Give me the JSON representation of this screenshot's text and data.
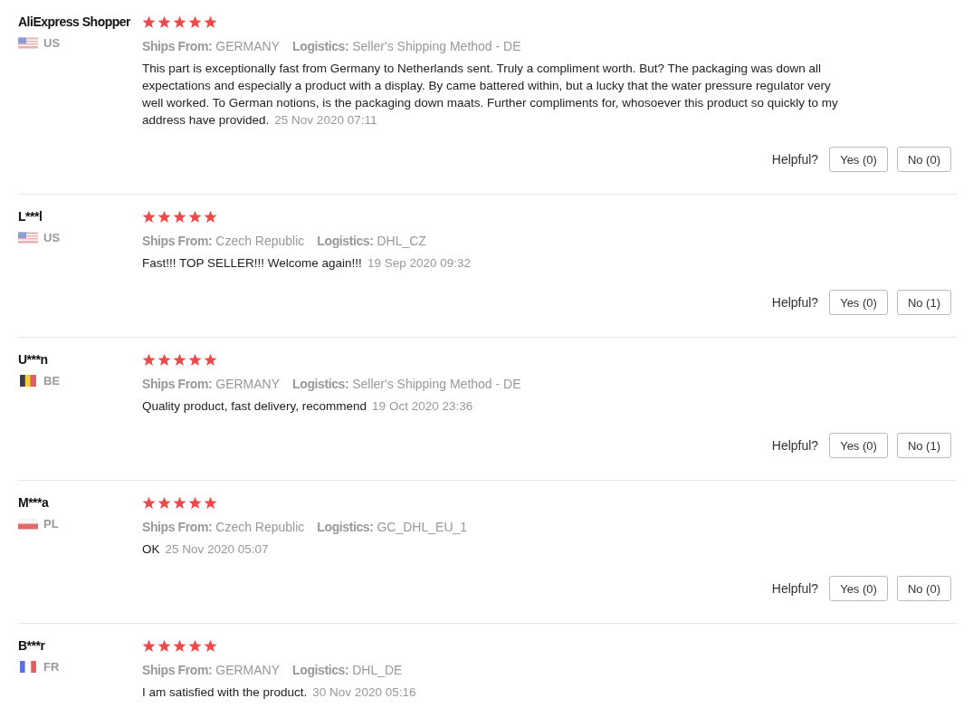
{
  "reviews": [
    {
      "name": "AliExpress Shopper",
      "kind": "us",
      "country": "US",
      "stars": 5,
      "ships_from_label": "Ships From:",
      "ships_from": "GERMANY",
      "logistics_label": "Logistics:",
      "logistics": "Seller's Shipping Method - DE",
      "text": "This part is exceptionally fast from Germany to Netherlands sent. Truly a compliment worth. But? The packaging was down all expectations and especially a product with a display. By came battered within, but a lucky that the water pressure regulator very well worked. To German notions, is the packaging down maats. Further compliments for, whosoever this product so quickly to my address have provided.",
      "date": "25 Nov 2020 07:11",
      "helpful": {
        "label": "Helpful?",
        "yes": "Yes (0)",
        "no": "No (0)"
      }
    },
    {
      "name": "L***l",
      "kind": "us",
      "country": "US",
      "stars": 5,
      "ships_from_label": "Ships From:",
      "ships_from": "Czech Republic",
      "logistics_label": "Logistics:",
      "logistics": "DHL_CZ",
      "text": "Fast!!! TOP SELLER!!! Welcome again!!!",
      "date": "19 Sep 2020 09:32",
      "helpful": {
        "label": "Helpful?",
        "yes": "Yes (0)",
        "no": "No (1)"
      }
    },
    {
      "name": "U***n",
      "kind": "be",
      "country": "BE",
      "stars": 5,
      "ships_from_label": "Ships From:",
      "ships_from": "GERMANY",
      "logistics_label": "Logistics:",
      "logistics": "Seller's Shipping Method - DE",
      "text": "Quality product, fast delivery, recommend",
      "date": "19 Oct 2020 23:36",
      "helpful": {
        "label": "Helpful?",
        "yes": "Yes (0)",
        "no": "No (1)"
      }
    },
    {
      "name": "M***a",
      "kind": "pl",
      "country": "PL",
      "stars": 5,
      "ships_from_label": "Ships From:",
      "ships_from": "Czech Republic",
      "logistics_label": "Logistics:",
      "logistics": "GC_DHL_EU_1",
      "text": "OK",
      "date": "25 Nov 2020 05:07",
      "helpful": {
        "label": "Helpful?",
        "yes": "Yes (0)",
        "no": "No (0)"
      }
    },
    {
      "name": "B***r",
      "kind": "fr",
      "country": "FR",
      "stars": 5,
      "ships_from_label": "Ships From:",
      "ships_from": "GERMANY",
      "logistics_label": "Logistics:",
      "logistics": "DHL_DE",
      "text": "I am satisfied with the product.",
      "date": "30 Nov 2020 05:16"
    }
  ]
}
